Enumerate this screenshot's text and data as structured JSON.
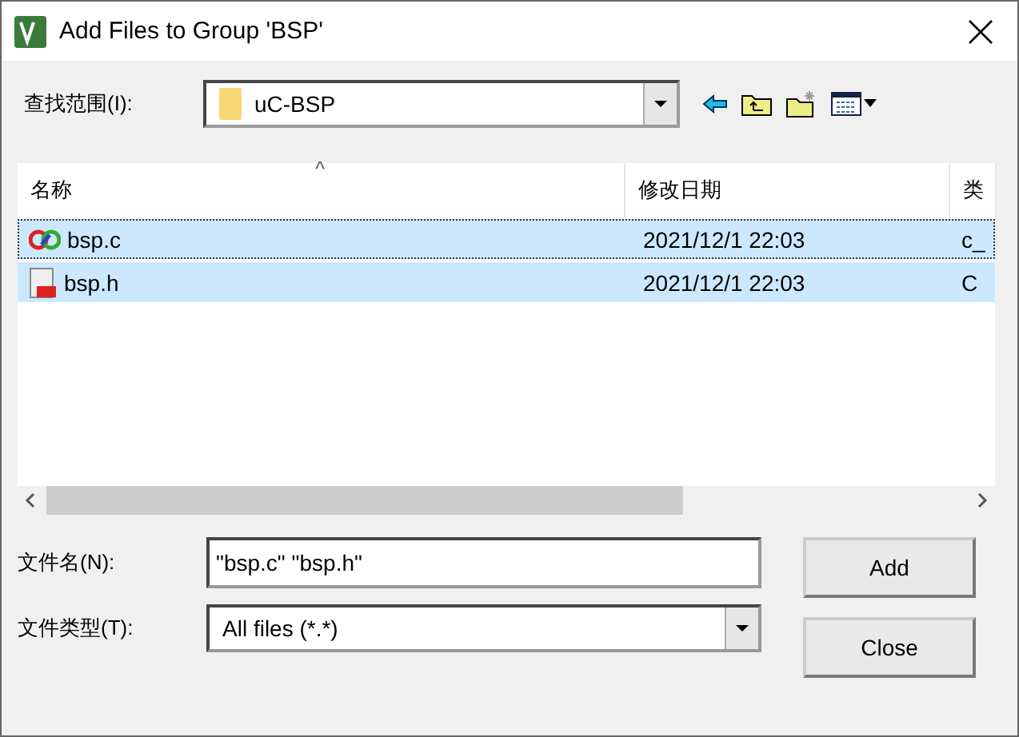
{
  "window": {
    "title": "Add Files to Group 'BSP'"
  },
  "look_in": {
    "label": "查找范围(I):",
    "value": "uC-BSP"
  },
  "file_list": {
    "sort_indicator": "^",
    "columns": [
      "名称",
      "修改日期",
      "类"
    ],
    "rows": [
      {
        "kind": "c",
        "name": "bsp.c",
        "modified": "2021/12/1 22:03",
        "type": "c_",
        "selected": true,
        "focused": true
      },
      {
        "kind": "h",
        "name": "bsp.h",
        "modified": "2021/12/1 22:03",
        "type": "C",
        "selected": true,
        "focused": false
      }
    ]
  },
  "file_name": {
    "label": "文件名(N):",
    "value": "\"bsp.c\" \"bsp.h\""
  },
  "file_type": {
    "label": "文件类型(T):",
    "value": "All files (*.*)"
  },
  "buttons": [
    "Add",
    "Close"
  ]
}
